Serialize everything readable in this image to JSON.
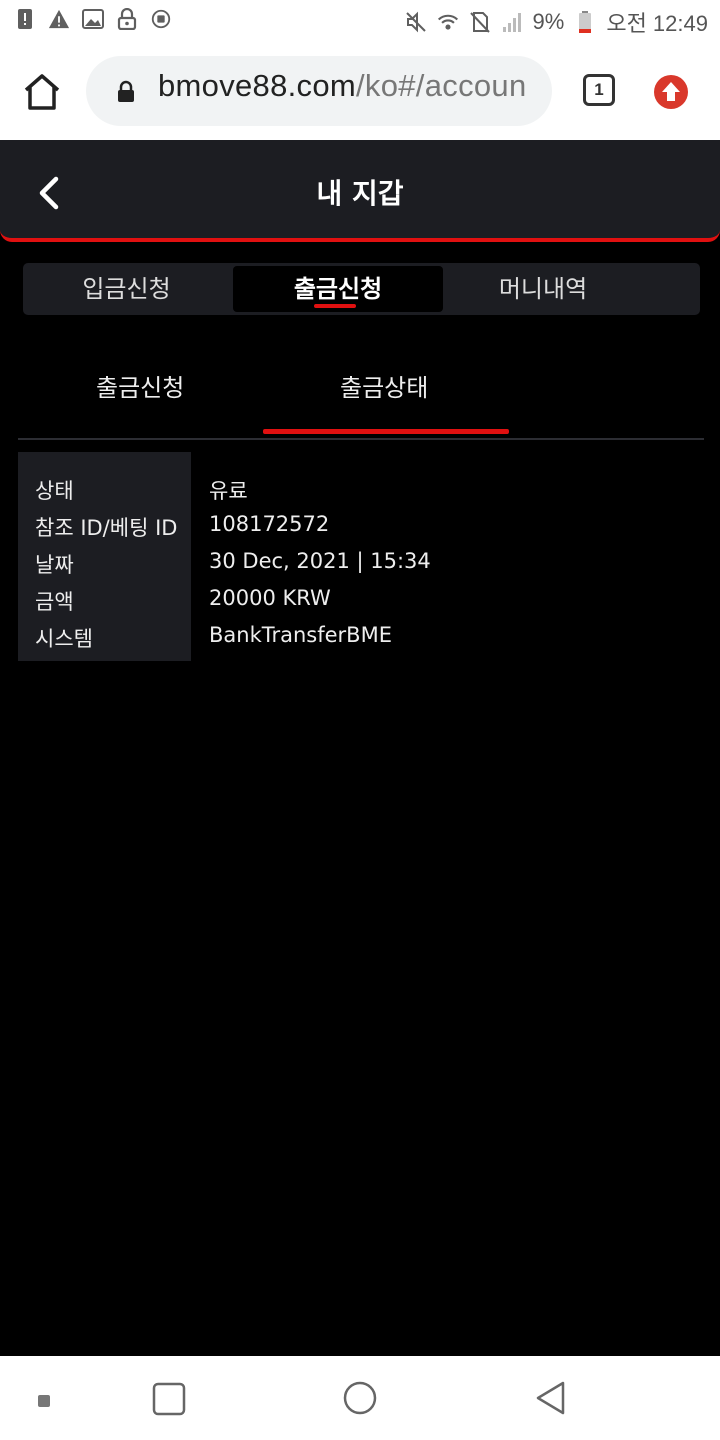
{
  "status_bar": {
    "battery_percent": "9%",
    "time": "오전 12:49",
    "left_icons": [
      "alert-icon",
      "warning-icon",
      "image-icon",
      "lock-icon",
      "sync-icon"
    ],
    "right_icons": [
      "mute-icon",
      "wifi-icon",
      "no-sim-icon",
      "signal-icon",
      "battery-low-icon"
    ]
  },
  "browser": {
    "url_domain": "bmove88.com",
    "url_rest": "/ko#/accoun",
    "tab_count": "1",
    "update_color": "#d9382b"
  },
  "header": {
    "title": "내 지갑",
    "accent_color": "#e01010"
  },
  "segment_tabs": [
    {
      "label": "입금신청",
      "active": false
    },
    {
      "label": "출금신청",
      "active": true
    },
    {
      "label": "머니내역",
      "active": false
    }
  ],
  "sub_tabs": [
    {
      "label": "출금신청",
      "active": false
    },
    {
      "label": "출금상태",
      "active": true
    }
  ],
  "withdrawal_status": [
    {
      "label": "상태",
      "value": "유료"
    },
    {
      "label": "참조 ID/베팅 ID",
      "value": "108172572"
    },
    {
      "label": "날짜",
      "value": "30 Dec, 2021 | 15:34"
    },
    {
      "label": "금액",
      "value": "20000 KRW"
    },
    {
      "label": "시스템",
      "value": "BankTransferBME"
    }
  ]
}
